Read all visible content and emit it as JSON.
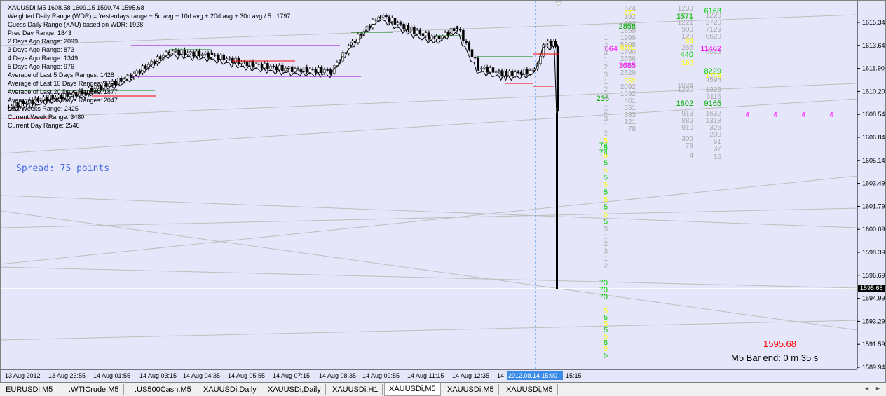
{
  "chart": {
    "symbol_header": "XAUUSDi,M5  1608.58 1609.15 1590.74 1595.68",
    "info_lines": [
      "Weighted Daily Range (WDR) = Yesterdays range + 5d avg + 10d avg + 20d avg + 30d avg / 5 : 1797",
      "Guess Daily Range (XAU) based on WDR: 1928",
      "Prev Day Range: 1843",
      "2 Days Ago Range: 2099",
      "3 Days Ago Range: 873",
      "4 Days Ago Range: 1349",
      "5 Days Ago Range: 976",
      "Average of Last 5 Days Ranges: 1428",
      "Average of Last 10 Days Ranges: 1798",
      "Average of Last 20 Days Ranges: 1877",
      "Average of Last 30 Days Ranges: 2047",
      "Last Weeks Range: 2425",
      "Current Week Range: 3480",
      "Current Day Range: 2546"
    ],
    "spread_text": "Spread: 75 points",
    "bid_price": "1595.68",
    "bar_end_text": "M5 Bar end: 0 m 35 s",
    "price_axis_labels": [
      "1615.34",
      "1613.64",
      "1611.90",
      "1610.20",
      "1608.54",
      "1606.84",
      "1605.14",
      "1603.49",
      "1601.79",
      "1600.09",
      "1598.39",
      "1596.69",
      "1594.99",
      "1593.29",
      "1591.59",
      "1589.94"
    ],
    "current_price_label": "1595.68",
    "time_axis_labels": [
      "13 Aug 2012",
      "13 Aug 23:55",
      "14 Aug 01:55",
      "14 Aug 03:15",
      "14 Aug 04:35",
      "14 Aug 05:55",
      "14 Aug 07:15",
      "14 Aug 08:35",
      "14 Aug 09:55",
      "14 Aug 11:15",
      "14 Aug 12:35",
      "14",
      "2012.08.14 15:00",
      "15:15"
    ],
    "magenta_fours": [
      "4",
      "4",
      "4",
      "4"
    ],
    "colors": {
      "background": "#e6e6fa",
      "bull": "#ffffff",
      "bear": "#000000",
      "ma": "#000000",
      "magenta": "#ff00ff",
      "green": "#00dd00",
      "yellow": "#ffff00",
      "gray": "#a9a9a9",
      "red": "#ff0000",
      "blue": "#1e90ff"
    }
  },
  "tabs": [
    {
      "label": "EURUSDi,M5",
      "active": false
    },
    {
      "label": ".WTICrude,M5",
      "active": false
    },
    {
      "label": ".US500Cash,M5",
      "active": false
    },
    {
      "label": "XAUUSDi,Daily",
      "active": false
    },
    {
      "label": "XAUUSDi,Daily",
      "active": false
    },
    {
      "label": "XAUUSDi,H1",
      "active": false
    },
    {
      "label": "XAUUSDi,M5",
      "active": true
    },
    {
      "label": "XAUUSDi,M5",
      "active": false
    },
    {
      "label": "XAUUSDi,M5",
      "active": false
    }
  ],
  "tabbar_arrows": {
    "left": "◄",
    "right": "►"
  }
}
